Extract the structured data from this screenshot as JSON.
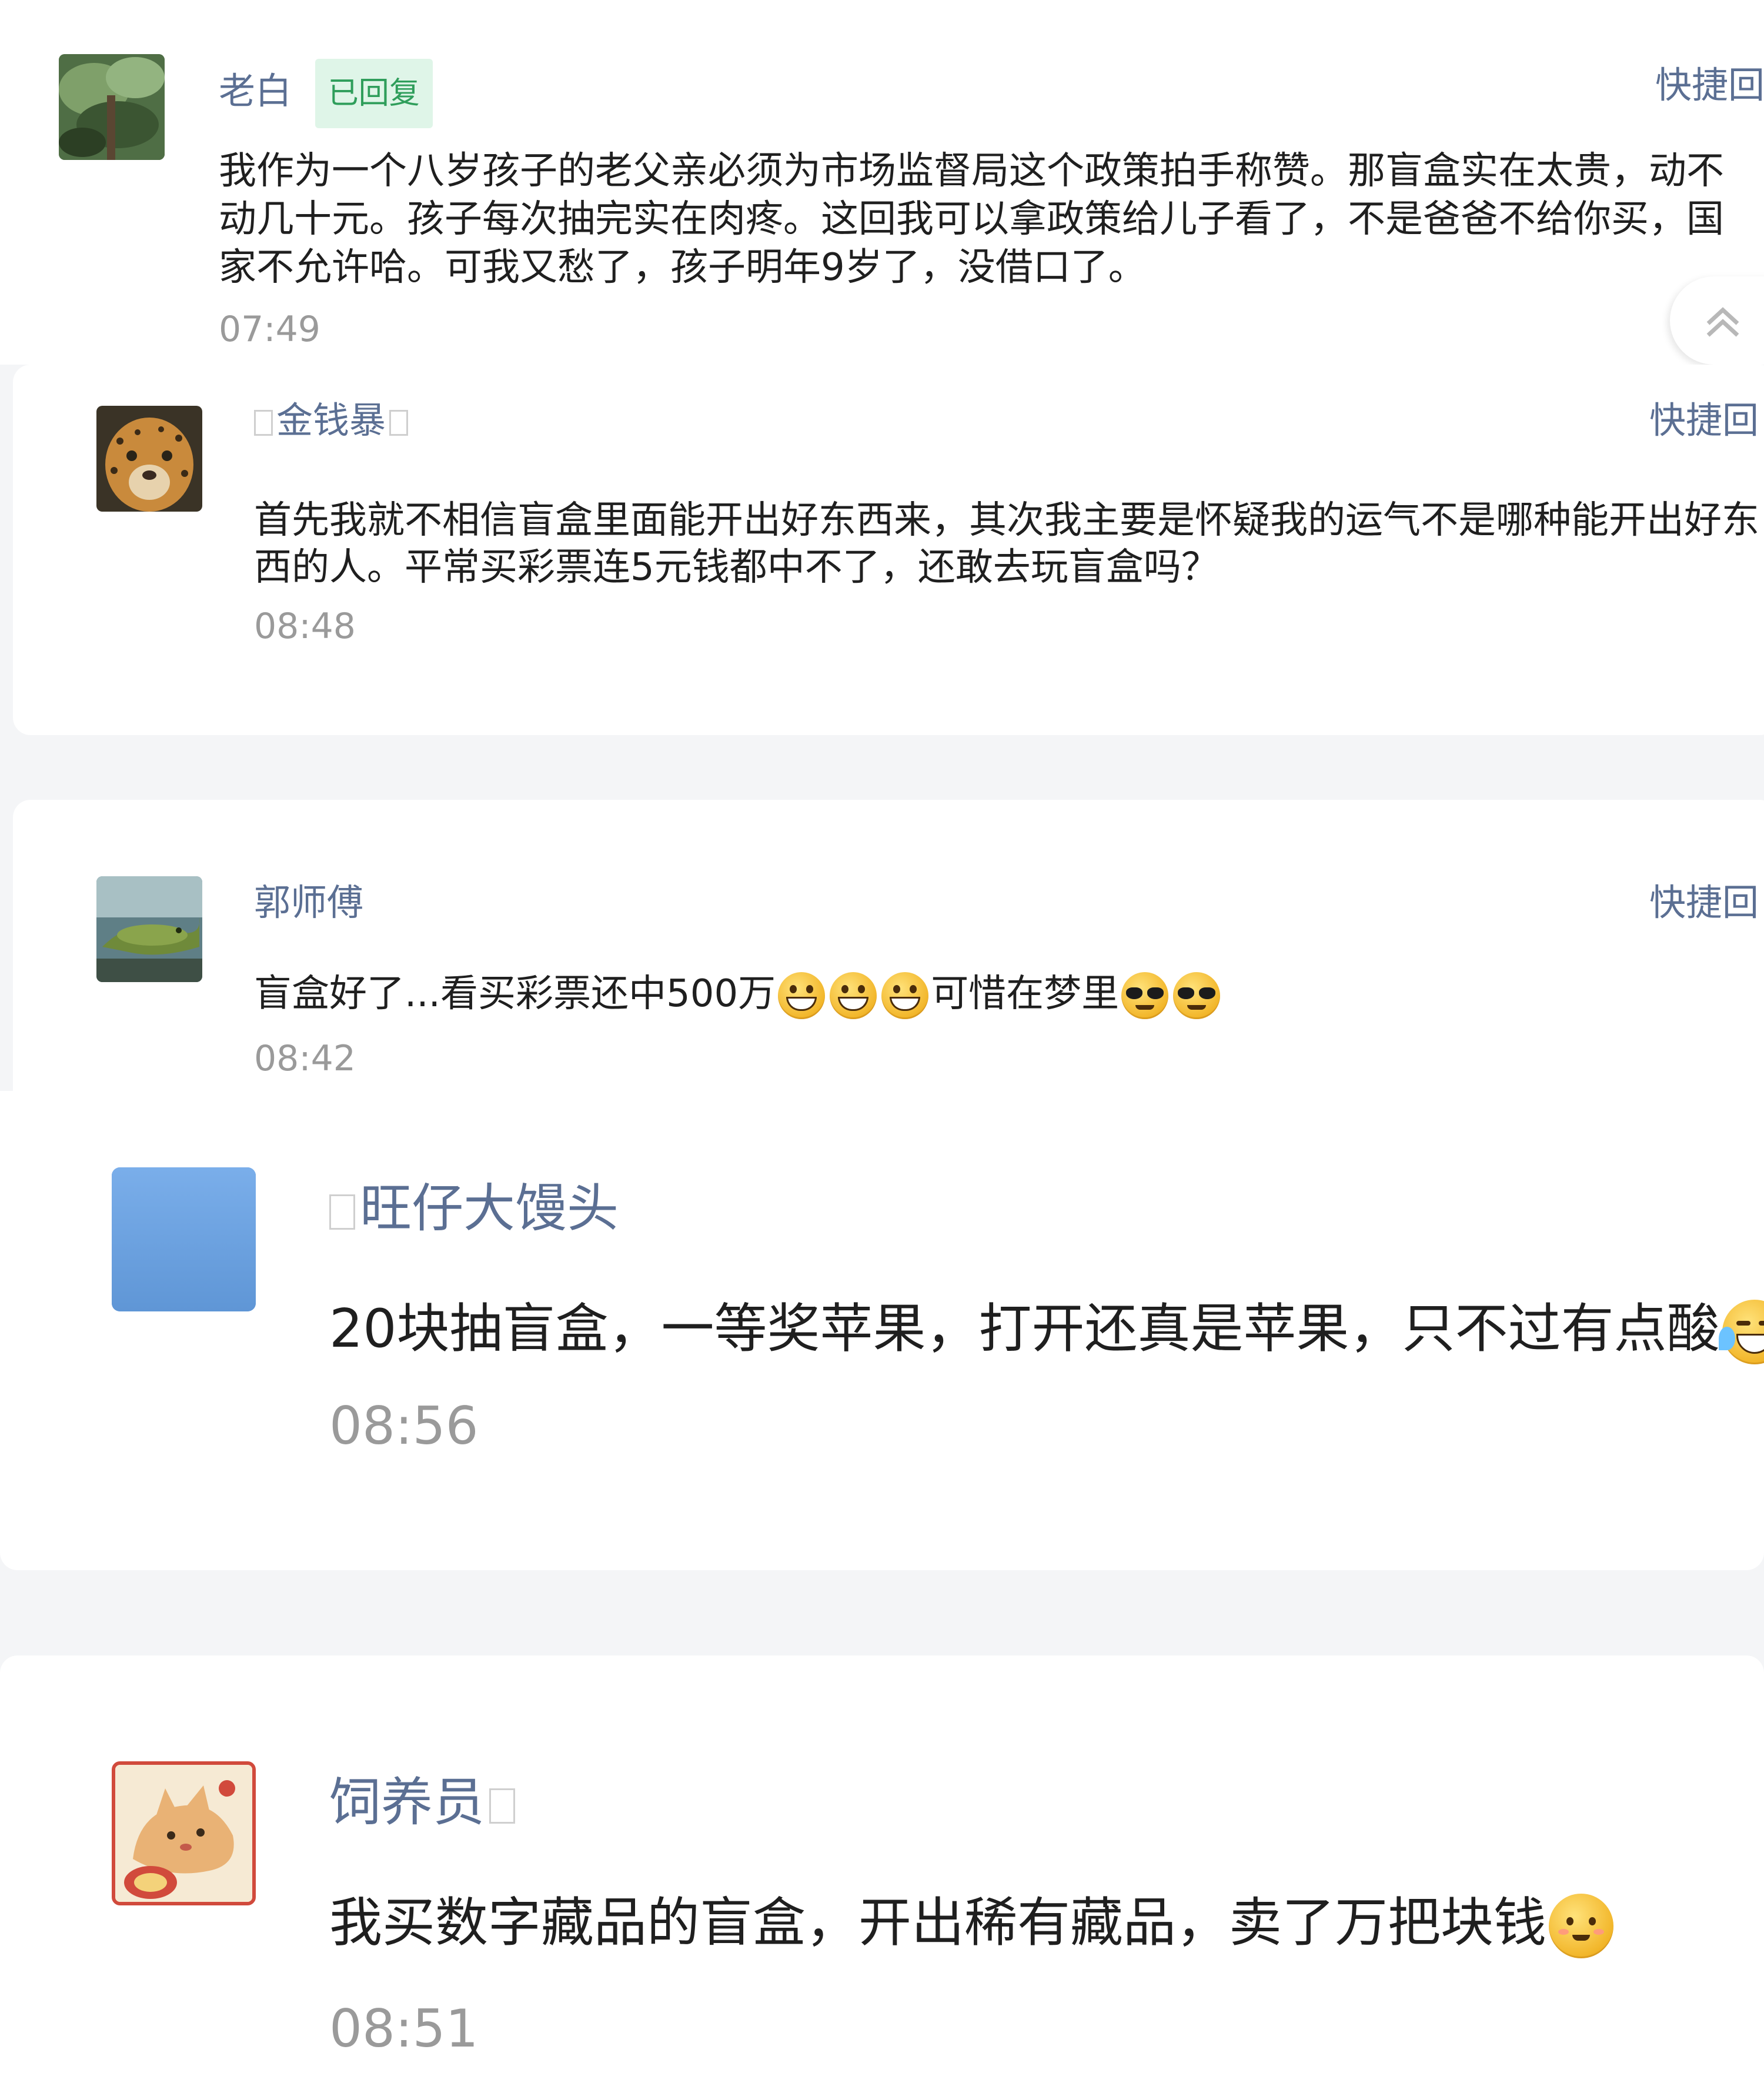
{
  "quick_reply_label": "快捷回",
  "comments": [
    {
      "name": "老白",
      "badge": "已回复",
      "text": "我作为一个八岁孩子的老父亲必须为市场监督局这个政策拍手称赞。那盲盒实在太贵，动不动几十元。孩子每次抽完实在肉疼。这回我可以拿政策给儿子看了，不是爸爸不给你买，国家不允许哈。可我又愁了，孩子明年9岁了，没借口了。",
      "time": "07:49",
      "avatar": "forest-photo-avatar"
    },
    {
      "name": "金钱暴",
      "text": "首先我就不相信盲盒里面能开出好东西来，其次我主要是怀疑我的运气不是哪种能开出好东西的人。平常买彩票连5元钱都中不了，还敢去玩盲盒吗？",
      "time": "08:48",
      "avatar": "leopard-photo-avatar"
    },
    {
      "name": "郭师傅",
      "text_a": "盲盒好了...看买彩票还中500万",
      "text_b": "可惜在梦里",
      "time": "08:42",
      "avatar": "lizard-photo-avatar",
      "emojis_a": [
        "grin-emoji",
        "grin-emoji",
        "grin-emoji"
      ],
      "emojis_b": [
        "sunglasses-emoji",
        "sunglasses-emoji"
      ]
    },
    {
      "name": "旺仔大馒头",
      "text": "20块抽盲盒，一等奖苹果，打开还真是苹果，只不过有点酸",
      "time": "08:56",
      "avatar": "blue-square-avatar",
      "emoji": "laugh-cry-emoji"
    },
    {
      "name": "饲养员",
      "text": "我买数字藏品的盲盒，开出稀有藏品，卖了万把块钱",
      "time": "08:51",
      "avatar": "cat-cartoon-avatar",
      "emoji": "smile-emoji"
    }
  ]
}
